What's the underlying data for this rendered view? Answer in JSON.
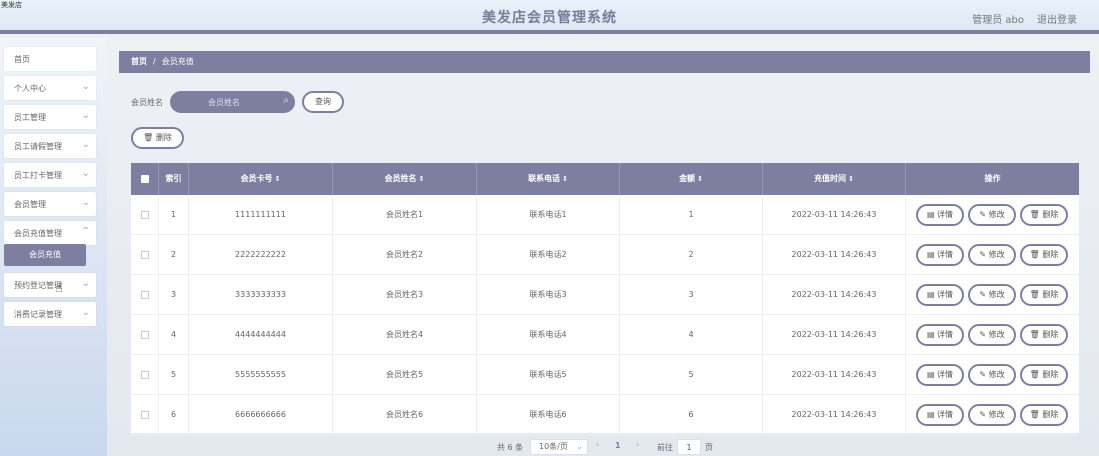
{
  "header": {
    "corner_text": "美发店",
    "title": "美发店会员管理系统",
    "admin": "管理员 abo",
    "logout": "退出登录"
  },
  "sidebar": {
    "items": [
      {
        "label": "首页",
        "has_arrow": false
      },
      {
        "label": "个人中心",
        "has_arrow": true
      },
      {
        "label": "员工管理",
        "has_arrow": true
      },
      {
        "label": "员工请假管理",
        "has_arrow": true
      },
      {
        "label": "员工打卡管理",
        "has_arrow": true
      },
      {
        "label": "会员管理",
        "has_arrow": true
      },
      {
        "label": "会员充值管理",
        "has_arrow": true
      },
      {
        "label": "预约登记管理",
        "has_arrow": true
      },
      {
        "label": "消费记录管理",
        "has_arrow": true
      }
    ],
    "active_sub": "会员充值"
  },
  "breadcrumb": {
    "home": "首页",
    "separator": "/",
    "current": "会员充值"
  },
  "search": {
    "label": "会员姓名",
    "placeholder": "会员姓名",
    "button": "查询"
  },
  "toolbar": {
    "delete": "删除"
  },
  "table": {
    "headers": [
      "索引",
      "会员卡号",
      "会员姓名",
      "联系电话",
      "金额",
      "充值时间",
      "操作"
    ],
    "rows": [
      {
        "index": "1",
        "card": "1111111111",
        "name": "会员姓名1",
        "phone": "联系电话1",
        "amount": "1",
        "time": "2022-03-11 14:26:43"
      },
      {
        "index": "2",
        "card": "2222222222",
        "name": "会员姓名2",
        "phone": "联系电话2",
        "amount": "2",
        "time": "2022-03-11 14:26:43"
      },
      {
        "index": "3",
        "card": "3333333333",
        "name": "会员姓名3",
        "phone": "联系电话3",
        "amount": "3",
        "time": "2022-03-11 14:26:43"
      },
      {
        "index": "4",
        "card": "4444444444",
        "name": "会员姓名4",
        "phone": "联系电话4",
        "amount": "4",
        "time": "2022-03-11 14:26:43"
      },
      {
        "index": "5",
        "card": "5555555555",
        "name": "会员姓名5",
        "phone": "联系电话5",
        "amount": "5",
        "time": "2022-03-11 14:26:43"
      },
      {
        "index": "6",
        "card": "6666666666",
        "name": "会员姓名6",
        "phone": "联系电话6",
        "amount": "6",
        "time": "2022-03-11 14:26:43"
      }
    ],
    "actions": {
      "detail": "详情",
      "edit": "修改",
      "delete": "删除"
    }
  },
  "pagination": {
    "total": "共 6 条",
    "page_size": "10条/页",
    "current_page": "1",
    "goto_label": "前往",
    "goto_value": "1",
    "page_unit": "页"
  },
  "colors": {
    "accent": "#7e7fa0",
    "sidebar_bg": "#c9d8ee"
  }
}
